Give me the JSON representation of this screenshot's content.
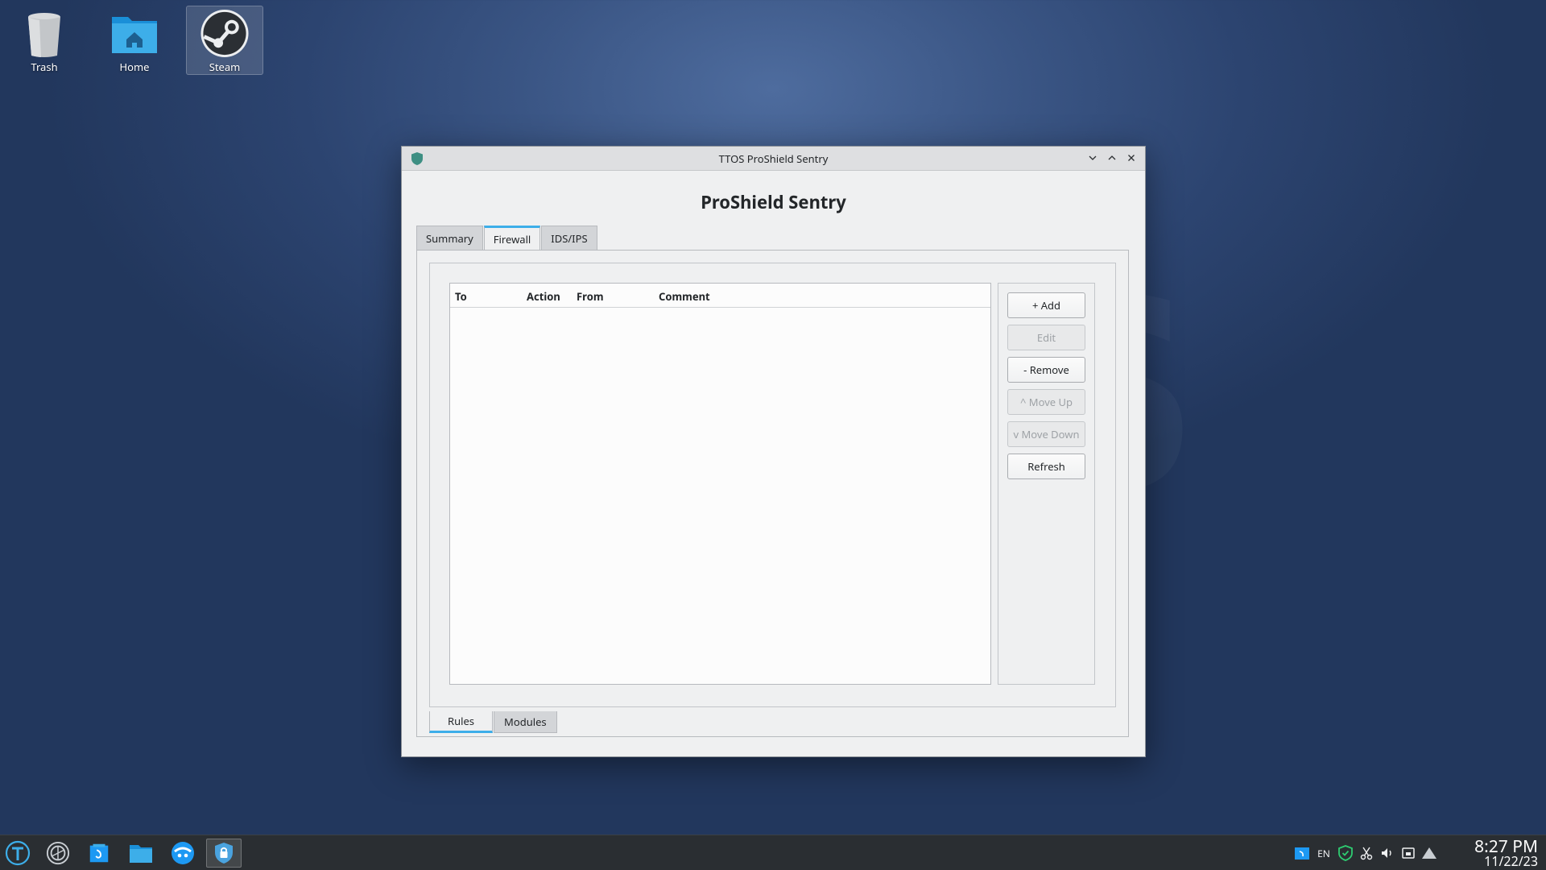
{
  "desktop": {
    "icons": [
      {
        "label": "Trash",
        "icon": "trash-icon"
      },
      {
        "label": "Home",
        "icon": "home-folder-icon"
      },
      {
        "label": "Steam",
        "icon": "steam-icon",
        "selected": true
      }
    ]
  },
  "window": {
    "title": "TTOS ProShield Sentry",
    "controls": [
      "minimize-icon",
      "maximize-icon",
      "close-icon"
    ],
    "app_title": "ProShield Sentry",
    "tabs": [
      {
        "label": "Summary",
        "active": false
      },
      {
        "label": "Firewall",
        "active": true
      },
      {
        "label": "IDS/IPS",
        "active": false
      }
    ],
    "table": {
      "columns": [
        "To",
        "Action",
        "From",
        "Comment"
      ],
      "rows": []
    },
    "buttons": [
      {
        "label": "+ Add",
        "enabled": true
      },
      {
        "label": "Edit",
        "enabled": false
      },
      {
        "label": "- Remove",
        "enabled": true
      },
      {
        "label": "^ Move Up",
        "enabled": false
      },
      {
        "label": "v Move Down",
        "enabled": false
      },
      {
        "label": "Refresh",
        "enabled": true
      }
    ],
    "bottom_tabs": [
      {
        "label": "Rules",
        "active": true
      },
      {
        "label": "Modules",
        "active": false
      }
    ]
  },
  "taskbar": {
    "launchers": [
      "app-menu-icon",
      "steam-icon",
      "discover-icon",
      "file-manager-icon",
      "browser-icon",
      "proshield-icon"
    ],
    "tray": {
      "language": "EN",
      "icons": [
        "discover-tray-icon",
        "shield-tray-icon",
        "scissors-icon",
        "volume-icon",
        "storage-icon",
        "network-icon"
      ]
    },
    "clock": {
      "time": "8:27 PM",
      "date": "11/22/23"
    }
  },
  "colors": {
    "accent": "#3daee9",
    "shield": "#3e8f83",
    "taskbar": "#2a2e32"
  }
}
